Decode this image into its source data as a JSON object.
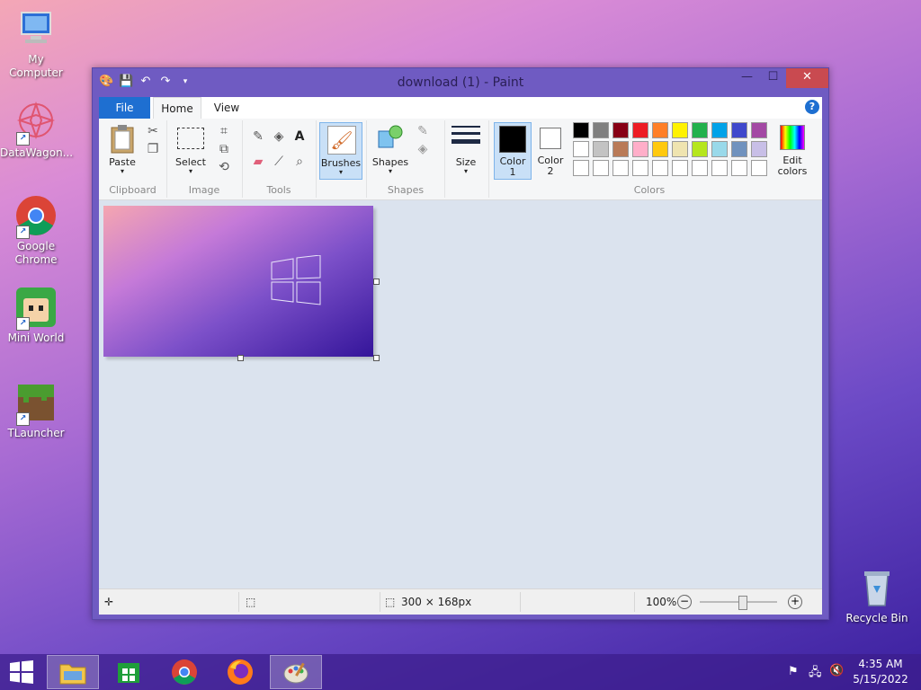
{
  "desktop": {
    "icons": [
      {
        "label": "My Computer"
      },
      {
        "label": "DataWagon..."
      },
      {
        "label": "Google Chrome"
      },
      {
        "label": "Mini World"
      },
      {
        "label": "TLauncher"
      },
      {
        "label": "Recycle Bin"
      }
    ]
  },
  "window": {
    "title": "download (1) - Paint",
    "min_glyph": "—",
    "max_glyph": "☐",
    "close_glyph": "✕"
  },
  "tabs": {
    "file": "File",
    "home": "Home",
    "view": "View",
    "help": "?"
  },
  "ribbon": {
    "clipboard": {
      "paste": "Paste",
      "group": "Clipboard"
    },
    "image": {
      "select": "Select",
      "group": "Image"
    },
    "tools": {
      "group": "Tools",
      "text_glyph": "A"
    },
    "brushes": {
      "label": "Brushes"
    },
    "shapes": {
      "label": "Shapes",
      "group": "Shapes"
    },
    "size": {
      "label": "Size"
    },
    "color1": {
      "line1": "Color",
      "line2": "1",
      "value": "#000000"
    },
    "color2": {
      "line1": "Color",
      "line2": "2",
      "value": "#ffffff"
    },
    "colors": {
      "group": "Colors",
      "row1": [
        "#000000",
        "#7f7f7f",
        "#880015",
        "#ed1c24",
        "#ff7f27",
        "#fff200",
        "#22b14c",
        "#00a2e8",
        "#3f48cc",
        "#a349a4"
      ],
      "row2": [
        "#ffffff",
        "#c3c3c3",
        "#b97a57",
        "#ffaec9",
        "#ffc90e",
        "#efe4b0",
        "#b5e61d",
        "#99d9ea",
        "#7092be",
        "#c8bfe7"
      ],
      "row3": [
        "#ffffff",
        "#ffffff",
        "#ffffff",
        "#ffffff",
        "#ffffff",
        "#ffffff",
        "#ffffff",
        "#ffffff",
        "#ffffff",
        "#ffffff"
      ]
    },
    "edit_colors": {
      "line1": "Edit",
      "line2": "colors"
    }
  },
  "statusbar": {
    "dimensions": "300 × 168px",
    "zoom": "100%",
    "zoom_level": 1.0
  },
  "taskbar": {
    "time": "4:35 AM",
    "date": "5/15/2022"
  }
}
